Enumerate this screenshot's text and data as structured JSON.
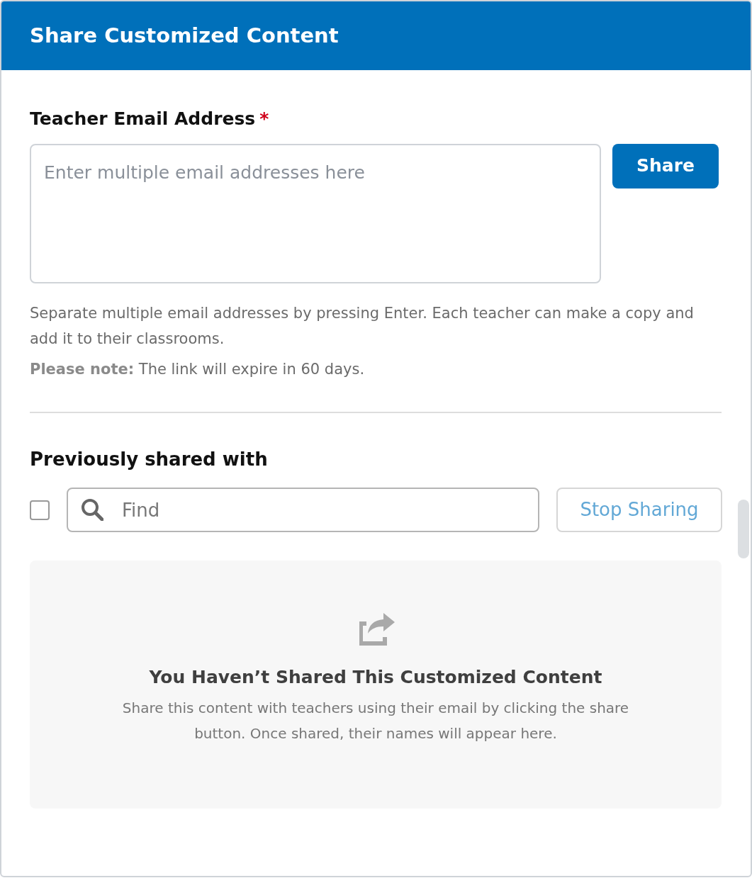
{
  "dialog": {
    "title": "Share Customized Content"
  },
  "email_field": {
    "label": "Teacher Email Address",
    "required_mark": "*",
    "placeholder": "Enter multiple email addresses here"
  },
  "share_button": "Share",
  "help_text": "Separate multiple email addresses by pressing Enter. Each teacher can make a copy and add it to their classrooms.",
  "note": "**Please note:** The link will expire in 60 days.",
  "shared_section": {
    "heading": "Previously shared with",
    "select_all": {
      "checked": false
    },
    "search": {
      "placeholder": "Find"
    },
    "stop_button": {
      "label": "Stop Sharing",
      "disabled": true
    },
    "empty_state": {
      "title": "You Haven’t Shared This Customized Content",
      "message": "Share this content with teachers using their email by clicking the share button. Once shared, their names will appear here."
    }
  }
}
